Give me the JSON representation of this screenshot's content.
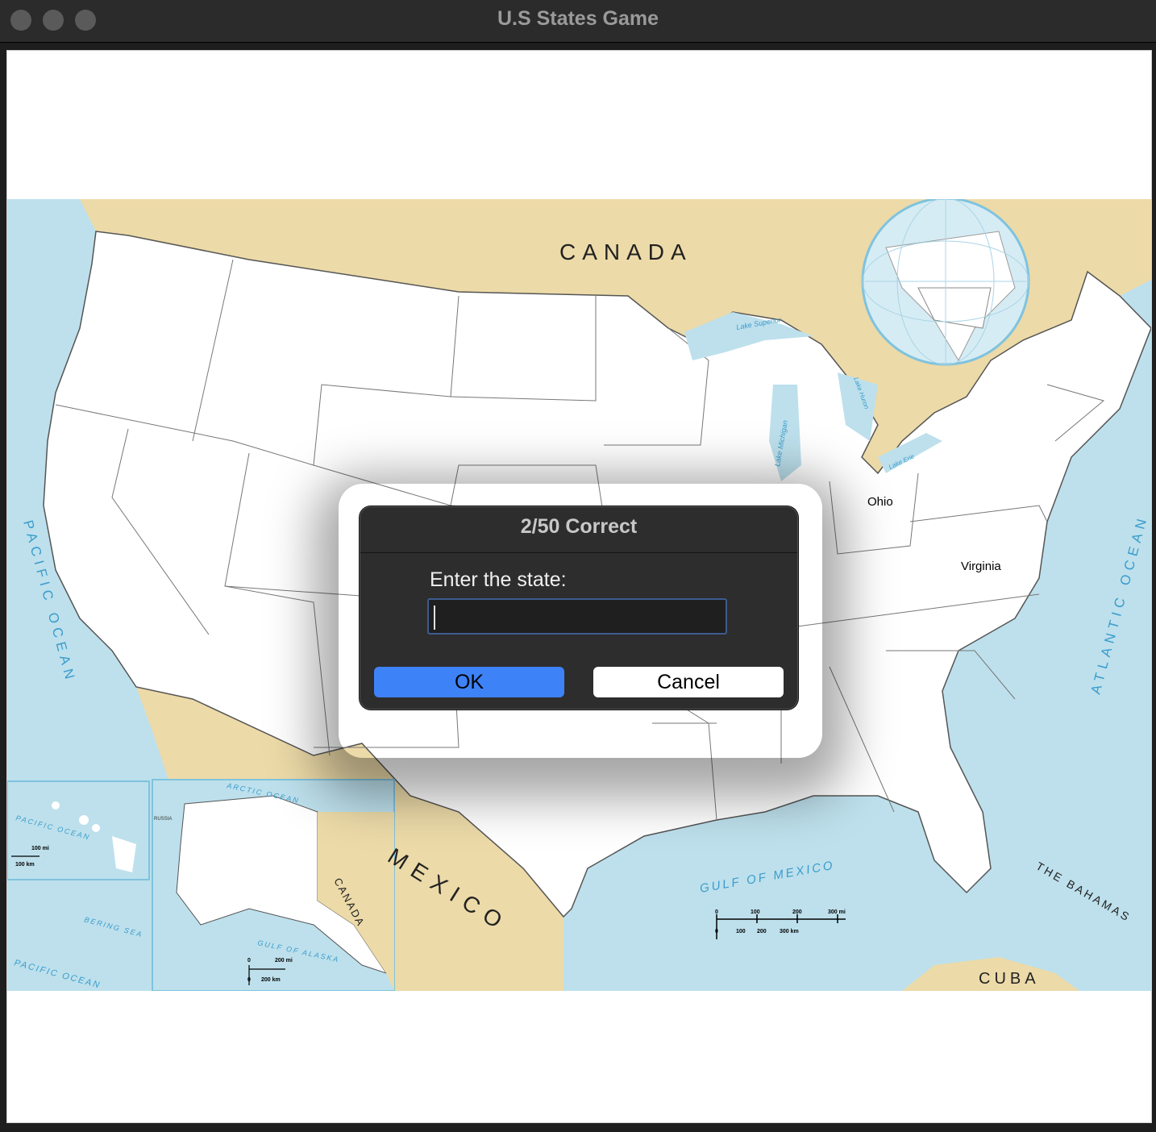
{
  "window": {
    "title": "U.S States Game"
  },
  "map": {
    "regions": {
      "canada": "CANADA",
      "mexico": "MEXICO",
      "canada_alaska": "CANADA",
      "cuba": "CUBA",
      "bahamas": "THE BAHAMAS",
      "pacific": "PACIFIC OCEAN",
      "atlantic": "ATLANTIC OCEAN",
      "gulf": "GULF OF MEXICO",
      "arctic": "ARCTIC OCEAN",
      "bering": "BERING SEA",
      "gulf_alaska": "GULF OF ALASKA",
      "pacific_hi": "PACIFIC OCEAN",
      "pacific_ak": "PACIFIC OCEAN",
      "russia": "RUSSIA",
      "lake_superior": "Lake Superior",
      "lake_michigan": "Lake Michigan",
      "lake_huron": "Lake Huron",
      "lake_erie": "Lake Erie"
    },
    "scales": {
      "main_mi": [
        "0",
        "100",
        "200",
        "300 mi"
      ],
      "main_km": [
        "0",
        "100",
        "200",
        "300 km"
      ],
      "hawaii": [
        "100 mi",
        "100 km"
      ],
      "alaska": [
        "0",
        "200 mi",
        "0",
        "200 km"
      ]
    },
    "guessed_states": [
      "Ohio",
      "Virginia"
    ],
    "colors": {
      "water": "#bde0ec",
      "land_foreign": "#ecdaa8",
      "states": "#ffffff",
      "border": "#555555",
      "label_water": "#3a9ccc"
    }
  },
  "dialog": {
    "title": "2/50 Correct",
    "prompt": "Enter the state:",
    "input_value": "",
    "ok_label": "OK",
    "cancel_label": "Cancel",
    "accent": "#3e82f7"
  }
}
